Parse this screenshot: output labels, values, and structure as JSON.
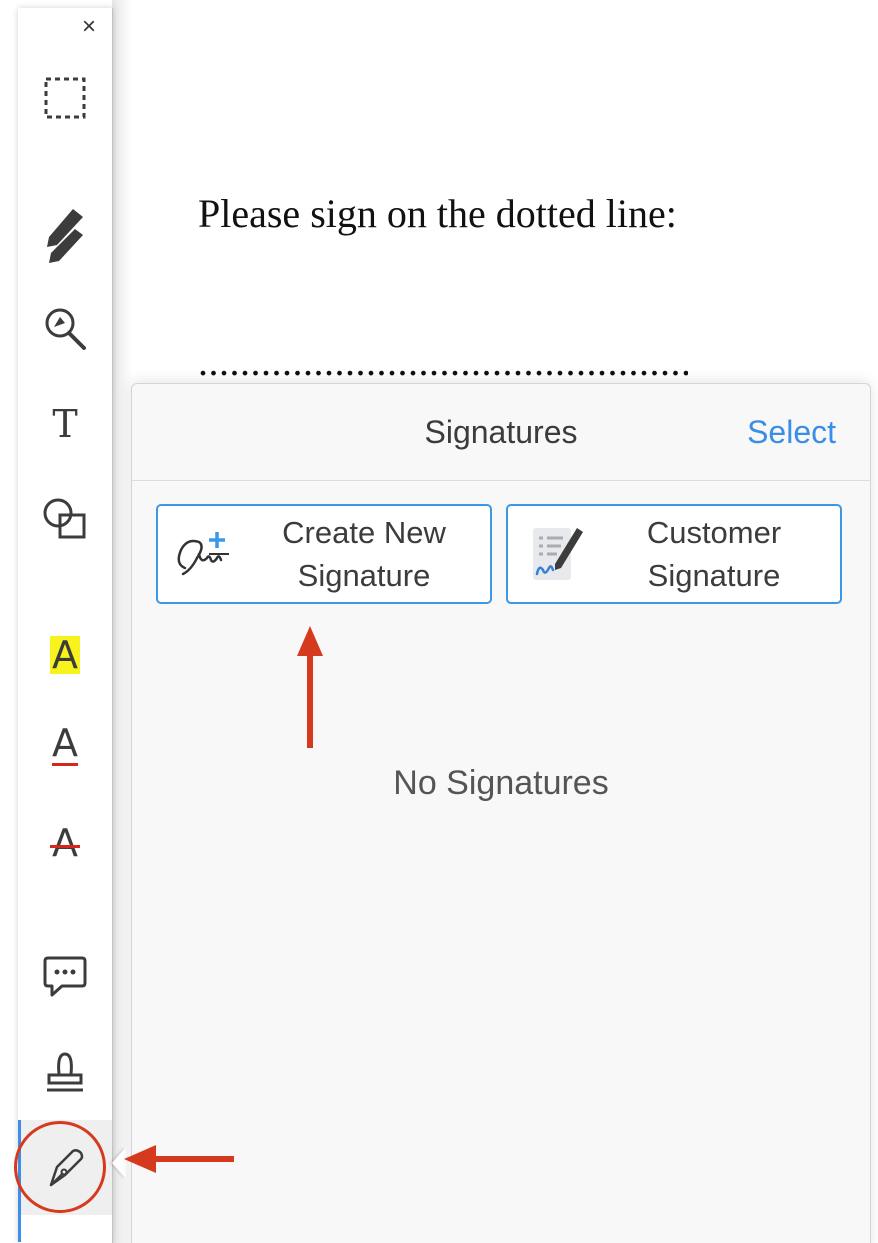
{
  "document": {
    "prompt_text": "Please sign on the dotted line:",
    "dotted_line": "................................................"
  },
  "toolbar": {
    "close_label": "×",
    "tools": [
      {
        "name": "selection-tool",
        "icon": "dashed-rectangle-icon"
      },
      {
        "name": "draw-tool",
        "icon": "pencil-icon"
      },
      {
        "name": "zoom-tool",
        "icon": "magnifier-icon"
      },
      {
        "name": "text-tool",
        "icon": "text-T-icon",
        "glyph": "T"
      },
      {
        "name": "shapes-tool",
        "icon": "shapes-icon"
      },
      {
        "name": "highlight-tool",
        "icon": "highlight-A-icon",
        "glyph": "A"
      },
      {
        "name": "underline-tool",
        "icon": "underline-A-icon",
        "glyph": "A"
      },
      {
        "name": "strikethrough-tool",
        "icon": "strikethrough-A-icon",
        "glyph": "A"
      },
      {
        "name": "comment-tool",
        "icon": "speech-bubble-icon"
      },
      {
        "name": "stamp-tool",
        "icon": "stamp-icon"
      },
      {
        "name": "signature-tool",
        "icon": "pen-nib-icon",
        "active": true
      }
    ],
    "active_color": "#3d8ee8"
  },
  "signatures_panel": {
    "title": "Signatures",
    "select_label": "Select",
    "create_new": {
      "line1": "Create New",
      "line2": "Signature"
    },
    "customer": {
      "line1": "Customer",
      "line2": "Signature"
    },
    "empty_text": "No Signatures",
    "accent_color": "#3a8ee6"
  },
  "annotation_color": "#d63a1e"
}
